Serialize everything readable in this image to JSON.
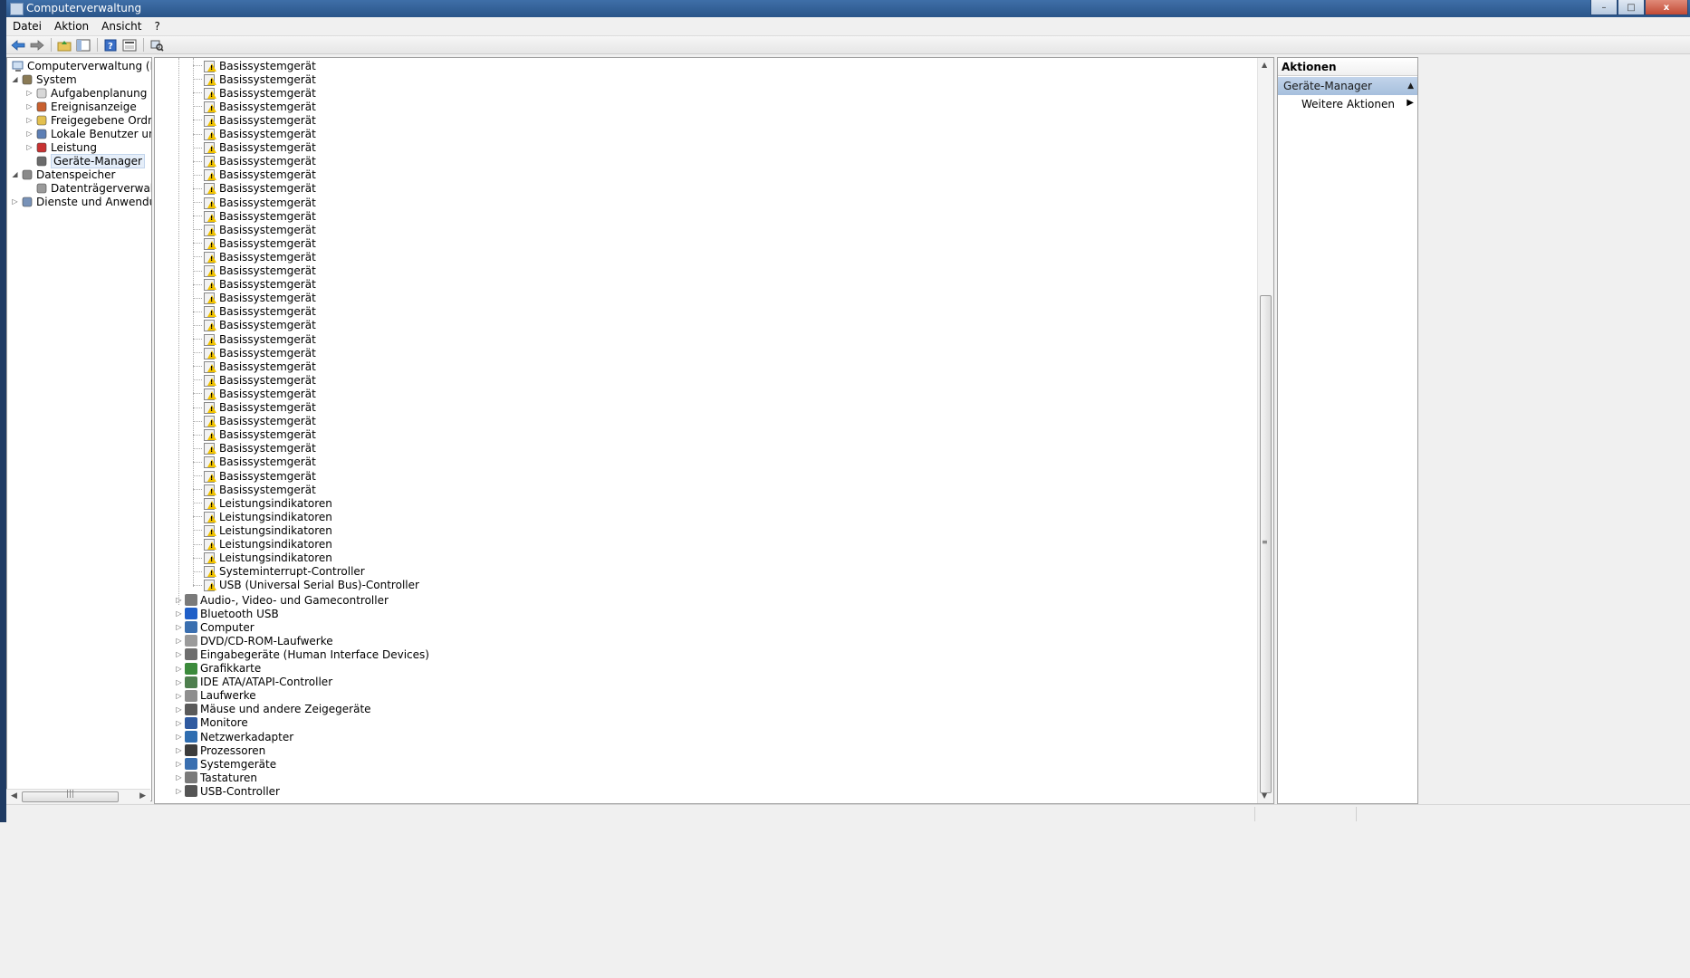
{
  "window": {
    "title": "Computerverwaltung",
    "min_label": "–",
    "max_label": "□",
    "close_label": "x"
  },
  "menu": [
    "Datei",
    "Aktion",
    "Ansicht",
    "?"
  ],
  "toolbar_icons": [
    "back-arrow-icon",
    "forward-arrow-icon",
    "up-folder-icon",
    "show-hide-tree-icon",
    "help-icon",
    "properties-icon",
    "scan-hardware-icon"
  ],
  "tree": {
    "root": "Computerverwaltung (Lokal)",
    "items": [
      {
        "label": "System",
        "level": 1,
        "expander": "◢",
        "icon": "tools-icon"
      },
      {
        "label": "Aufgabenplanung",
        "level": 2,
        "expander": "▷",
        "icon": "clock-icon"
      },
      {
        "label": "Ereignisanzeige",
        "level": 2,
        "expander": "▷",
        "icon": "event-viewer-icon"
      },
      {
        "label": "Freigegebene Ordner",
        "level": 2,
        "expander": "▷",
        "icon": "shared-folder-icon"
      },
      {
        "label": "Lokale Benutzer und Gruppen",
        "level": 2,
        "expander": "▷",
        "icon": "users-icon"
      },
      {
        "label": "Leistung",
        "level": 2,
        "expander": "▷",
        "icon": "performance-icon"
      },
      {
        "label": "Geräte-Manager",
        "level": 2,
        "expander": "",
        "icon": "device-manager-icon",
        "selected": true
      },
      {
        "label": "Datenspeicher",
        "level": 1,
        "expander": "◢",
        "icon": "storage-icon"
      },
      {
        "label": "Datenträgerverwaltung",
        "level": 2,
        "expander": "",
        "icon": "disk-management-icon"
      },
      {
        "label": "Dienste und Anwendungen",
        "level": 1,
        "expander": "▷",
        "icon": "services-icon"
      }
    ]
  },
  "devices": {
    "children": [
      "Basissystemgerät",
      "Basissystemgerät",
      "Basissystemgerät",
      "Basissystemgerät",
      "Basissystemgerät",
      "Basissystemgerät",
      "Basissystemgerät",
      "Basissystemgerät",
      "Basissystemgerät",
      "Basissystemgerät",
      "Basissystemgerät",
      "Basissystemgerät",
      "Basissystemgerät",
      "Basissystemgerät",
      "Basissystemgerät",
      "Basissystemgerät",
      "Basissystemgerät",
      "Basissystemgerät",
      "Basissystemgerät",
      "Basissystemgerät",
      "Basissystemgerät",
      "Basissystemgerät",
      "Basissystemgerät",
      "Basissystemgerät",
      "Basissystemgerät",
      "Basissystemgerät",
      "Basissystemgerät",
      "Basissystemgerät",
      "Basissystemgerät",
      "Basissystemgerät",
      "Basissystemgerät",
      "Basissystemgerät",
      "Leistungsindikatoren",
      "Leistungsindikatoren",
      "Leistungsindikatoren",
      "Leistungsindikatoren",
      "Leistungsindikatoren",
      "Systeminterrupt-Controller",
      "USB (Universal Serial Bus)-Controller"
    ],
    "categories": [
      {
        "label": "Audio-, Video- und Gamecontroller",
        "icon": "speaker-icon",
        "color": "#7a7a7a"
      },
      {
        "label": "Bluetooth USB",
        "icon": "bluetooth-icon",
        "color": "#1f5fc8"
      },
      {
        "label": "Computer",
        "icon": "computer-icon",
        "color": "#3a6fb0"
      },
      {
        "label": "DVD/CD-ROM-Laufwerke",
        "icon": "dvd-drive-icon",
        "color": "#9a9a9a"
      },
      {
        "label": "Eingabegeräte (Human Interface Devices)",
        "icon": "hid-icon",
        "color": "#6d6d6d"
      },
      {
        "label": "Grafikkarte",
        "icon": "graphics-card-icon",
        "color": "#3b8a3b"
      },
      {
        "label": "IDE ATA/ATAPI-Controller",
        "icon": "ide-controller-icon",
        "color": "#4e7f4e"
      },
      {
        "label": "Laufwerke",
        "icon": "disk-drive-icon",
        "color": "#8e8e8e"
      },
      {
        "label": "Mäuse und andere Zeigegeräte",
        "icon": "mouse-icon",
        "color": "#5a5a5a"
      },
      {
        "label": "Monitore",
        "icon": "monitor-icon",
        "color": "#2f5aa0"
      },
      {
        "label": "Netzwerkadapter",
        "icon": "network-adapter-icon",
        "color": "#2f6db0"
      },
      {
        "label": "Prozessoren",
        "icon": "processor-icon",
        "color": "#3c3c3c"
      },
      {
        "label": "Systemgeräte",
        "icon": "system-devices-icon",
        "color": "#3a6fb0"
      },
      {
        "label": "Tastaturen",
        "icon": "keyboard-icon",
        "color": "#7a7a7a"
      },
      {
        "label": "USB-Controller",
        "icon": "usb-icon",
        "color": "#555555"
      }
    ]
  },
  "actions": {
    "header": "Aktionen",
    "section": "Geräte-Manager",
    "item": "Weitere Aktionen"
  }
}
